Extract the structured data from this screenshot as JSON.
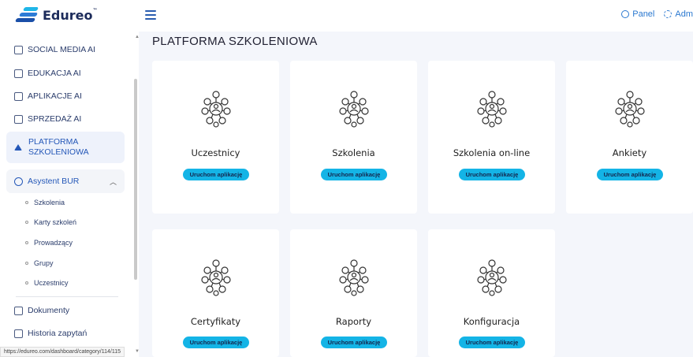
{
  "header": {
    "logo_text": "Edureo",
    "logo_tm": "™",
    "panel_label": "Panel",
    "admin_label": "Adm"
  },
  "sidebar": {
    "items": [
      {
        "label": "SOCIAL MEDIA AI",
        "icon": "social-icon"
      },
      {
        "label": "EDUKACJA AI",
        "icon": "education-icon"
      },
      {
        "label": "APLIKACJE AI",
        "icon": "apps-icon"
      },
      {
        "label": "SPRZEDAŻ AI",
        "icon": "cart-icon"
      }
    ],
    "active": {
      "line1": "PLATFORMA",
      "line2": "SZKOLENIOWA",
      "icon": "layers-icon"
    },
    "group": {
      "label": "Asystent BUR",
      "icon": "users-icon",
      "expanded": true
    },
    "subitems": [
      "Szkolenia",
      "Karty szkoleń",
      "Prowadzący",
      "Grupy",
      "Uczestnicy"
    ],
    "bottom": [
      {
        "label": "Dokumenty",
        "icon": "document-icon"
      },
      {
        "label": "Historia zapytań",
        "icon": "history-icon"
      }
    ]
  },
  "status_url": "https://edureo.com/dashboard/category/114/115",
  "main": {
    "title": "PLATFORMA SZKOLENIOWA",
    "button_label": "Uruchom aplikację",
    "cards": [
      {
        "title": "Uczestnicy"
      },
      {
        "title": "Szkolenia"
      },
      {
        "title": "Szkolenia on-line"
      },
      {
        "title": "Ankiety"
      },
      {
        "title": "Certyfikaty"
      },
      {
        "title": "Raporty"
      },
      {
        "title": "Konfiguracja"
      }
    ]
  },
  "colors": {
    "accent": "#14b4e6",
    "brand": "#2558b8"
  }
}
